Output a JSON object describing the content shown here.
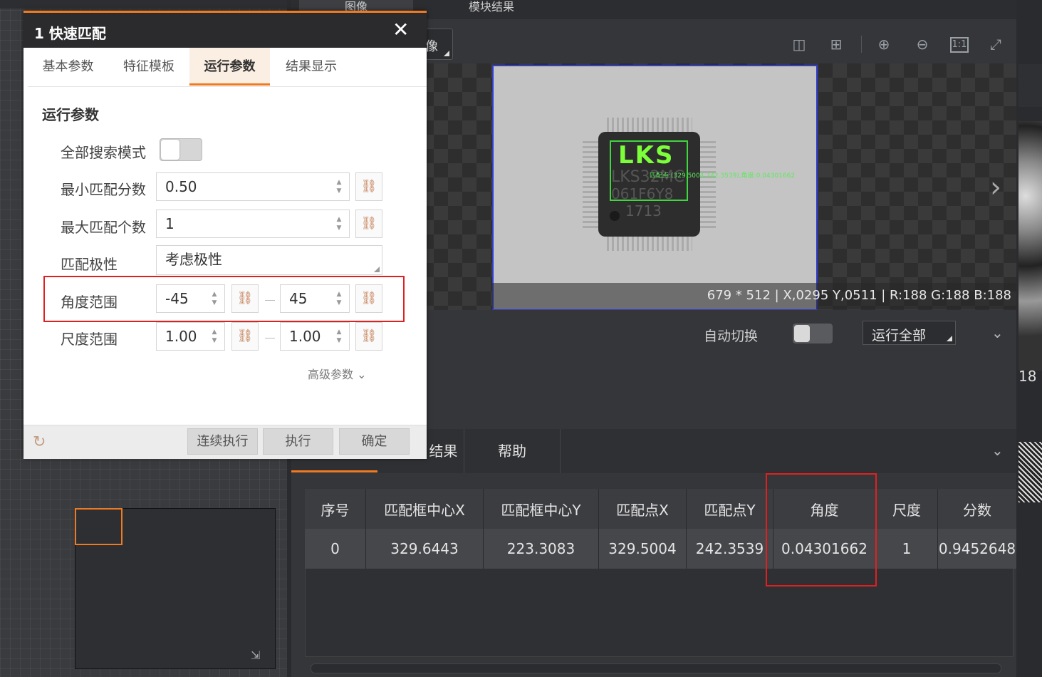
{
  "top_tabs": {
    "image": "图像",
    "module_results": "模块结果"
  },
  "image_view": {
    "source_label": "像",
    "pixel_info": "679 * 512  |  X,0295  Y,0511  |  R:188  G:188  B:188",
    "chip_text_1": "LKS",
    "chip_text_2": "LKS32MC",
    "chip_text_3": "061F6Y8",
    "chip_text_4": "1713",
    "match_overlay_label": "匹配点:(329.5004,242.3539),角度:0.04301662"
  },
  "toolbar_icons": [
    "split-view-icon",
    "grid-view-icon",
    "zoom-in-icon",
    "zoom-out-icon",
    "actual-size-icon",
    "fit-window-icon"
  ],
  "controls": {
    "auto_switch_label": "自动切换",
    "auto_switch_on": false,
    "run_all_label": "运行全部"
  },
  "result_tabs": {
    "results": "结果",
    "help": "帮助"
  },
  "result_table": {
    "headers": [
      "序号",
      "匹配框中心X",
      "匹配框中心Y",
      "匹配点X",
      "匹配点Y",
      "角度",
      "尺度",
      "分数"
    ],
    "rows": [
      [
        "0",
        "329.6443",
        "223.3083",
        "329.5004",
        "242.3539",
        "0.04301662",
        "1",
        "0.9452648"
      ]
    ]
  },
  "right_strip": {
    "number": "18"
  },
  "dialog": {
    "title": "1 快速匹配",
    "tabs": [
      "基本参数",
      "特征模板",
      "运行参数",
      "结果显示"
    ],
    "active_tab": "运行参数",
    "section_title": "运行参数",
    "params": {
      "search_all_label": "全部搜索模式",
      "search_all_on": false,
      "min_score_label": "最小匹配分数",
      "min_score_value": "0.50",
      "max_count_label": "最大匹配个数",
      "max_count_value": "1",
      "polarity_label": "匹配极性",
      "polarity_value": "考虑极性",
      "angle_label": "角度范围",
      "angle_min": "-45",
      "angle_max": "45",
      "scale_label": "尺度范围",
      "scale_min": "1.00",
      "scale_max": "1.00"
    },
    "advanced_label": "高级参数",
    "footer": {
      "continuous": "连续执行",
      "execute": "执行",
      "confirm": "确定"
    }
  },
  "colors": {
    "accent": "#f07a22",
    "highlight_red": "#e02020",
    "match_green": "#3fd63f",
    "frame_blue": "#2f3ccf"
  }
}
